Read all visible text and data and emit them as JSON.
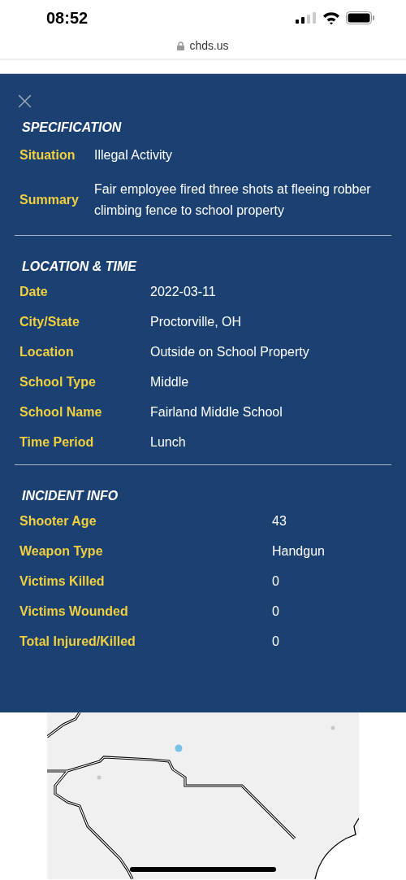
{
  "status_bar": {
    "time": "08:52"
  },
  "browser": {
    "url": "chds.us"
  },
  "panel": {
    "close": "×",
    "sections": [
      {
        "title": "SPECIFICATION",
        "rows": [
          {
            "label": "Situation",
            "value": "Illegal Activity"
          },
          {
            "label": "Summary",
            "value": "Fair employee fired three shots at fleeing robber climbing fence to school property"
          }
        ]
      },
      {
        "title": "LOCATION & TIME",
        "rows": [
          {
            "label": "Date",
            "value": "2022-03-11"
          },
          {
            "label": "City/State",
            "value": "Proctorville, OH"
          },
          {
            "label": "Location",
            "value": "Outside on School Property"
          },
          {
            "label": "School Type",
            "value": "Middle"
          },
          {
            "label": "School Name",
            "value": "Fairland Middle School"
          },
          {
            "label": "Time Period",
            "value": "Lunch"
          }
        ]
      },
      {
        "title": "INCIDENT INFO",
        "rows": [
          {
            "label": "Shooter Age",
            "value": "43"
          },
          {
            "label": "Weapon Type",
            "value": "Handgun"
          },
          {
            "label": "Victims Killed",
            "value": "0"
          },
          {
            "label": "Victims Wounded",
            "value": "0"
          },
          {
            "label": "Total Injured/Killed",
            "value": "0"
          }
        ]
      }
    ]
  }
}
